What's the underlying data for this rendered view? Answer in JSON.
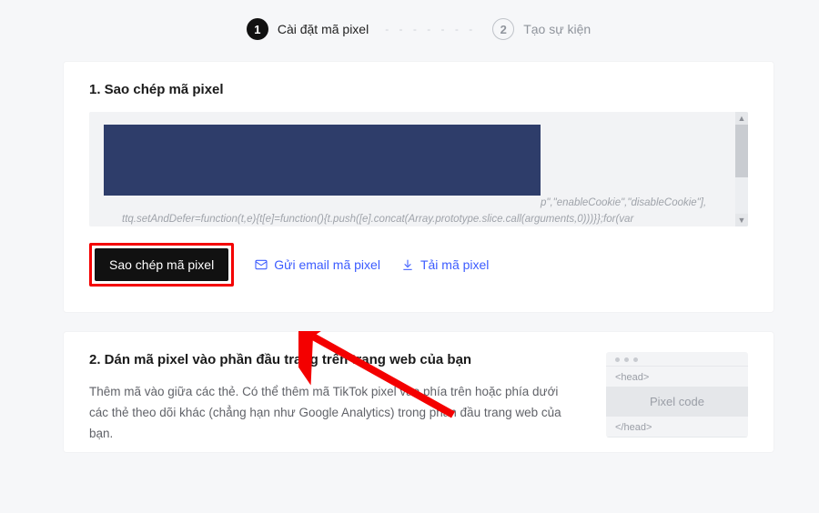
{
  "stepper": {
    "step1_number": "1",
    "step1_label": "Cài đặt mã pixel",
    "divider": "- - - - - - -",
    "step2_number": "2",
    "step2_label": "Tạo sự kiện"
  },
  "section1": {
    "title": "1. Sao chép mã pixel",
    "code_tail": "p\",\"enableCookie\",\"disableCookie\"],",
    "code_line2": "ttq.setAndDefer=function(t,e){t[e]=function(){t.push([e].concat(Array.prototype.slice.call(arguments,0)))}};for(var",
    "copy_button": "Sao chép mã pixel",
    "email_link": "Gửi email mã pixel",
    "download_link": "Tải mã pixel"
  },
  "section2": {
    "title": "2. Dán mã pixel vào phần đầu trang trên trang web của bạn",
    "desc": "Thêm mã vào giữa các thẻ. Có thể thêm mã TikTok pixel vào phía trên hoặc phía dưới các thẻ theo dõi khác (chẳng hạn như Google Analytics) trong phần đầu trang web của bạn.",
    "right": {
      "head_open": "<head>",
      "pixel_code": "Pixel code",
      "head_close": "</head>"
    }
  }
}
